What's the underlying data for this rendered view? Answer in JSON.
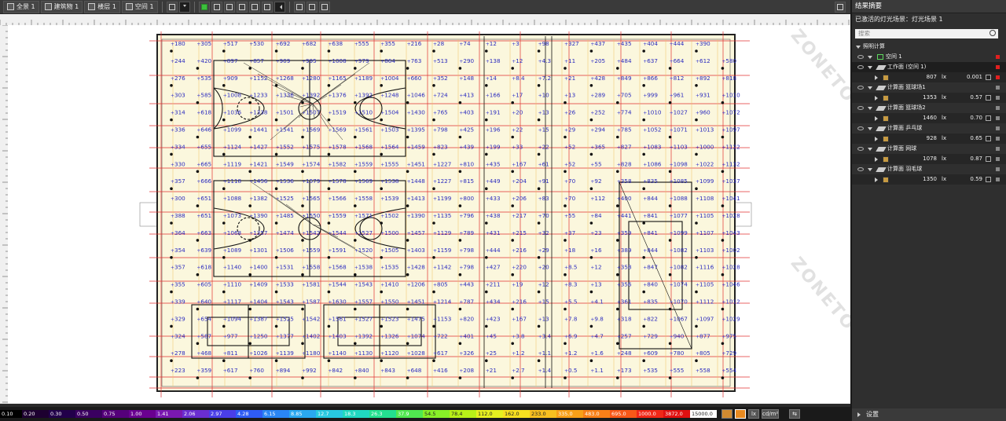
{
  "toolbar": {
    "tabs": [
      {
        "label": "全景 1",
        "icon": "globe-icon"
      },
      {
        "label": "建筑物 1",
        "icon": "building-icon"
      },
      {
        "label": "楼层 1",
        "icon": "floor-icon"
      },
      {
        "label": "空间 1",
        "icon": "room-icon"
      }
    ]
  },
  "panel": {
    "title": "结果摘要",
    "scene": "已激活的灯光场景：灯光场景 1",
    "search_placeholder": "搜索",
    "section": "照明计算",
    "room": "空间 1",
    "rows": [
      {
        "label": "工作面 (空间 1)",
        "value": "807",
        "unit": "lx",
        "ratio": "0.001",
        "status": "red",
        "selected": true
      },
      {
        "label": "计算面 篮球场1",
        "value": "1353",
        "unit": "lx",
        "ratio": "0.57",
        "status": "gray"
      },
      {
        "label": "计算面 篮球场2",
        "value": "1460",
        "unit": "lx",
        "ratio": "0.70",
        "status": "gray"
      },
      {
        "label": "计算面 乒乓球",
        "value": "928",
        "unit": "lx",
        "ratio": "0.65",
        "status": "gray"
      },
      {
        "label": "计算面 网球",
        "value": "1078",
        "unit": "lx",
        "ratio": "0.87",
        "status": "gray"
      },
      {
        "label": "计算面 羽毛球",
        "value": "1350",
        "unit": "lx",
        "ratio": "0.59",
        "status": "gray"
      }
    ],
    "settings": "设置"
  },
  "legend": {
    "values": [
      "0.10",
      "0.20",
      "0.30",
      "0.50",
      "0.75",
      "1.00",
      "1.41",
      "2.06",
      "2.97",
      "4.28",
      "6.15",
      "8.85",
      "12.7",
      "18.3",
      "26.3",
      "37.9",
      "54.5",
      "78.4",
      "112.0",
      "162.0",
      "233.0",
      "335.0",
      "483.0",
      "695.0",
      "1000.0",
      "3872.0",
      "15000.0"
    ],
    "colors": [
      "#000000",
      "#1d0030",
      "#22004a",
      "#3a0060",
      "#55007a",
      "#6a0090",
      "#7a18b0",
      "#6a2ed0",
      "#4a3ee8",
      "#2f5cf5",
      "#2a86f5",
      "#2aa8f0",
      "#28c8e0",
      "#20d8c0",
      "#24e090",
      "#50e850",
      "#88f028",
      "#b8f018",
      "#e6f020",
      "#f8e020",
      "#f8c020",
      "#f8a018",
      "#f88018",
      "#f85818",
      "#f02818",
      "#e01010",
      "#ffffff"
    ],
    "unit_lx": "lx",
    "unit_cd": "cd/m²"
  },
  "grid": {
    "rows": [
      [
        "180",
        "305",
        "517",
        "530",
        "692",
        "682",
        "638",
        "555",
        "355",
        "216",
        "28",
        "74",
        "12",
        "3",
        "98",
        "327",
        "437",
        "435",
        "404",
        "444",
        "390"
      ],
      [
        "244",
        "420",
        "897",
        "857",
        "909",
        "995",
        "1008",
        "979",
        "864",
        "763",
        "513",
        "290",
        "138",
        "12",
        "4.3",
        "11",
        "205",
        "484",
        "637",
        "664",
        "612",
        "580"
      ],
      [
        "276",
        "535",
        "909",
        "1152",
        "1268",
        "1280",
        "1165",
        "1189",
        "1004",
        "660",
        "352",
        "148",
        "14",
        "8.4",
        "7.2",
        "21",
        "428",
        "849",
        "866",
        "812",
        "892",
        "818"
      ],
      [
        "303",
        "585",
        "1008",
        "1233",
        "1336",
        "1392",
        "1376",
        "1392",
        "1248",
        "1046",
        "724",
        "413",
        "166",
        "17",
        "10",
        "13",
        "289",
        "705",
        "999",
        "961",
        "931",
        "1010"
      ],
      [
        "314",
        "618",
        "1036",
        "1338",
        "1501",
        "1507",
        "1519",
        "1510",
        "1504",
        "1430",
        "765",
        "403",
        "191",
        "20",
        "13",
        "26",
        "252",
        "774",
        "1010",
        "1027",
        "960",
        "1072"
      ],
      [
        "336",
        "646",
        "1099",
        "1441",
        "1541",
        "1569",
        "1569",
        "1561",
        "1503",
        "1395",
        "798",
        "425",
        "196",
        "22",
        "15",
        "29",
        "294",
        "785",
        "1052",
        "1071",
        "1013",
        "1097"
      ],
      [
        "334",
        "655",
        "1124",
        "1427",
        "1552",
        "1575",
        "1578",
        "1568",
        "1564",
        "1459",
        "823",
        "439",
        "199",
        "33",
        "22",
        "52",
        "365",
        "827",
        "1083",
        "1103",
        "1000",
        "1122"
      ],
      [
        "330",
        "665",
        "1119",
        "1421",
        "1549",
        "1574",
        "1582",
        "1559",
        "1555",
        "1451",
        "1227",
        "810",
        "435",
        "167",
        "61",
        "52",
        "55",
        "828",
        "1086",
        "1098",
        "1022",
        "1132"
      ],
      [
        "357",
        "666",
        "1118",
        "1456",
        "1536",
        "1579",
        "1578",
        "1569",
        "1538",
        "1448",
        "1227",
        "815",
        "449",
        "204",
        "91",
        "70",
        "92",
        "358",
        "835",
        "1085",
        "1099",
        "1037"
      ],
      [
        "300",
        "651",
        "1088",
        "1382",
        "1525",
        "1565",
        "1566",
        "1558",
        "1539",
        "1413",
        "1199",
        "800",
        "433",
        "206",
        "83",
        "70",
        "112",
        "400",
        "844",
        "1088",
        "1108",
        "1041"
      ],
      [
        "388",
        "651",
        "1073",
        "1390",
        "1485",
        "1550",
        "1559",
        "1571",
        "1502",
        "1390",
        "1135",
        "796",
        "438",
        "217",
        "70",
        "55",
        "84",
        "441",
        "841",
        "1077",
        "1105",
        "1028"
      ],
      [
        "364",
        "663",
        "1068",
        "1357",
        "1474",
        "1542",
        "1544",
        "1527",
        "1500",
        "1457",
        "1129",
        "789",
        "431",
        "215",
        "32",
        "37",
        "23",
        "359",
        "841",
        "1099",
        "1107",
        "1043"
      ],
      [
        "354",
        "639",
        "1089",
        "1301",
        "1506",
        "1559",
        "1591",
        "1520",
        "1505",
        "1403",
        "1159",
        "798",
        "444",
        "216",
        "29",
        "18",
        "16",
        "389",
        "844",
        "1082",
        "1103",
        "1002"
      ],
      [
        "357",
        "618",
        "1140",
        "1400",
        "1531",
        "1558",
        "1568",
        "1538",
        "1535",
        "1428",
        "1142",
        "798",
        "427",
        "220",
        "20",
        "8.5",
        "12",
        "358",
        "847",
        "1082",
        "1116",
        "1028"
      ],
      [
        "355",
        "605",
        "1110",
        "1409",
        "1533",
        "1581",
        "1544",
        "1543",
        "1410",
        "1206",
        "805",
        "443",
        "211",
        "19",
        "12",
        "8.3",
        "13",
        "356",
        "840",
        "1074",
        "1105",
        "1046"
      ],
      [
        "339",
        "640",
        "1117",
        "1404",
        "1543",
        "1587",
        "1630",
        "1557",
        "1550",
        "1451",
        "1214",
        "787",
        "434",
        "216",
        "15",
        "5.5",
        "4.1",
        "361",
        "835",
        "1070",
        "1112",
        "1012"
      ],
      [
        "329",
        "654",
        "1094",
        "1387",
        "1525",
        "1542",
        "1561",
        "1527",
        "1523",
        "1475",
        "1153",
        "820",
        "423",
        "167",
        "13",
        "7.8",
        "9.8",
        "318",
        "822",
        "1067",
        "1097",
        "1029"
      ],
      [
        "324",
        "587",
        "977",
        "1250",
        "1377",
        "1402",
        "1403",
        "1392",
        "1326",
        "1074",
        "722",
        "401",
        "45",
        "3.8",
        "3.4",
        "6.9",
        "4.7",
        "257",
        "729",
        "940",
        "877",
        "975"
      ],
      [
        "278",
        "468",
        "811",
        "1026",
        "1139",
        "1180",
        "1140",
        "1130",
        "1120",
        "1028",
        "617",
        "326",
        "25",
        "1.2",
        "1.1",
        "1.2",
        "1.6",
        "248",
        "609",
        "780",
        "805",
        "729"
      ],
      [
        "223",
        "359",
        "617",
        "760",
        "894",
        "992",
        "842",
        "840",
        "843",
        "648",
        "416",
        "208",
        "21",
        "2.7",
        "1.4",
        "0.5",
        "1.1",
        "173",
        "535",
        "555",
        "558",
        "554"
      ]
    ]
  }
}
